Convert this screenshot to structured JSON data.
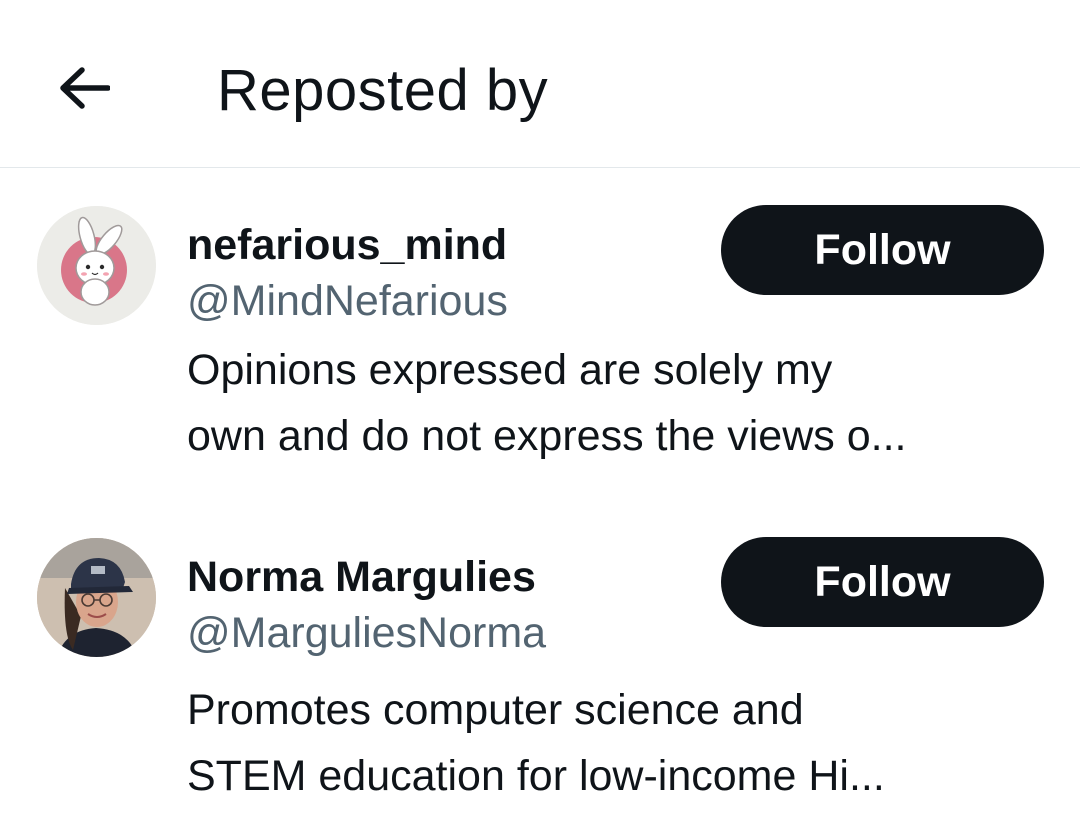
{
  "header": {
    "title": "Reposted by",
    "back_icon": "arrow-left-icon"
  },
  "users": [
    {
      "display_name": "nefarious_mind",
      "handle": "@MindNefarious",
      "bio_line1": "Opinions expressed are solely my",
      "bio_line2": "own and do not express the views o...",
      "follow_label": "Follow",
      "avatar_icon": "bunny-avatar"
    },
    {
      "display_name": "Norma Margulies",
      "handle": "@MarguliesNorma",
      "bio_line1": "Promotes computer science and",
      "bio_line2": "STEM education for low-income Hi...",
      "follow_label": "Follow",
      "avatar_icon": "person-photo-avatar"
    }
  ],
  "colors": {
    "text": "#0f1419",
    "secondary_text": "#536471",
    "divider": "#e3e8eb",
    "button_bg": "#0f1419",
    "button_text": "#ffffff"
  }
}
